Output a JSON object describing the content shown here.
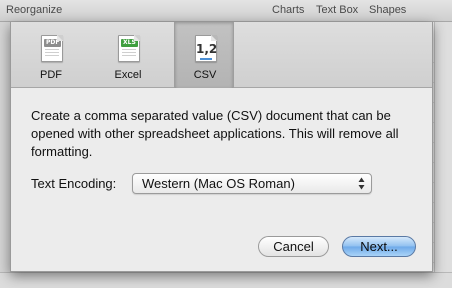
{
  "toolbar": {
    "reorganize": "Reorganize",
    "charts": "Charts",
    "text_box": "Text Box",
    "shapes": "Shapes"
  },
  "export_dialog": {
    "formats": [
      {
        "label": "PDF",
        "icon": "pdf-document-icon",
        "badge": "PDF",
        "selected": false
      },
      {
        "label": "Excel",
        "icon": "excel-document-icon",
        "badge": "XLS",
        "selected": false
      },
      {
        "label": "CSV",
        "icon": "csv-document-icon",
        "badge": "1,2",
        "selected": true
      }
    ],
    "description": "Create a comma separated value (CSV) document that can be opened with other spreadsheet applications. This will remove all formatting.",
    "encoding": {
      "label": "Text Encoding:",
      "value": "Western (Mac OS Roman)"
    },
    "buttons": {
      "cancel": "Cancel",
      "next": "Next..."
    }
  },
  "colors": {
    "dialog_bg": "#ececec",
    "default_button": "#8fc0f0",
    "csv_accent": "#4a8fd6",
    "xls_badge": "#3f9f3f"
  }
}
